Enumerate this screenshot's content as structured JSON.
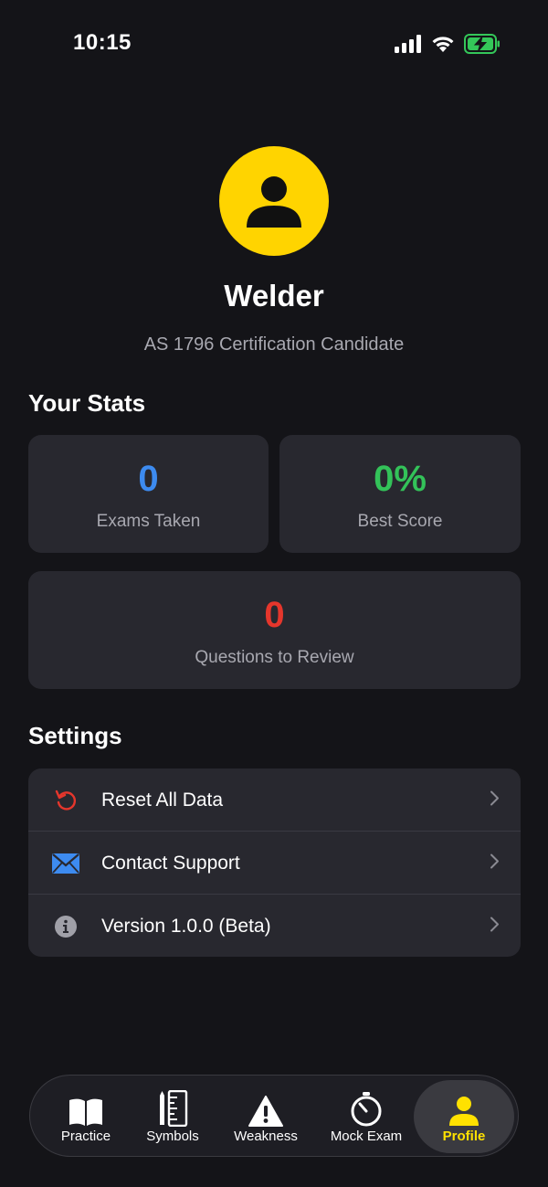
{
  "status_bar": {
    "time": "10:15"
  },
  "profile": {
    "name": "Welder",
    "subtitle": "AS 1796 Certification Candidate"
  },
  "stats": {
    "title": "Your Stats",
    "exams_taken": {
      "value": "0",
      "label": "Exams Taken",
      "color": "#3d8bf0"
    },
    "best_score": {
      "value": "0%",
      "label": "Best Score",
      "color": "#33c259"
    },
    "questions_to_review": {
      "value": "0",
      "label": "Questions to Review",
      "color": "#e5362c"
    }
  },
  "settings": {
    "title": "Settings",
    "items": [
      {
        "label": "Reset All Data",
        "icon": "reset-icon"
      },
      {
        "label": "Contact Support",
        "icon": "envelope-icon"
      },
      {
        "label": "Version 1.0.0 (Beta)",
        "icon": "info-icon"
      }
    ]
  },
  "tabs": [
    {
      "label": "Practice",
      "icon": "book-icon",
      "active": false
    },
    {
      "label": "Symbols",
      "icon": "ruler-pencil-icon",
      "active": false
    },
    {
      "label": "Weakness",
      "icon": "warning-icon",
      "active": false
    },
    {
      "label": "Mock Exam",
      "icon": "timer-icon",
      "active": false
    },
    {
      "label": "Profile",
      "icon": "person-icon",
      "active": true
    }
  ],
  "colors": {
    "accent": "#FFD400",
    "background": "#141418",
    "card": "#28282f"
  }
}
